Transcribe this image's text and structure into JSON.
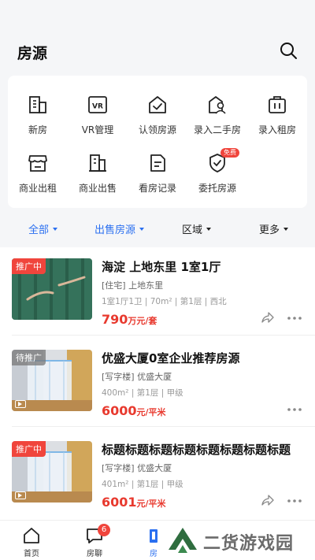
{
  "header": {
    "title": "房源"
  },
  "grid": [
    {
      "label": "新房",
      "icon": "building-icon"
    },
    {
      "label": "VR管理",
      "icon": "vr-icon"
    },
    {
      "label": "认领房源",
      "icon": "claim-house-icon"
    },
    {
      "label": "录入二手房",
      "icon": "add-used-house-icon"
    },
    {
      "label": "录入租房",
      "icon": "add-rental-icon"
    },
    {
      "label": "商业出租",
      "icon": "shop-icon"
    },
    {
      "label": "商业出售",
      "icon": "office-building-icon"
    },
    {
      "label": "看房记录",
      "icon": "record-icon"
    },
    {
      "label": "委托房源",
      "icon": "entrust-shield-icon",
      "badge": "免费"
    }
  ],
  "filters": [
    {
      "label": "全部",
      "active": true
    },
    {
      "label": "出售房源",
      "active": true
    },
    {
      "label": "区域",
      "active": false
    },
    {
      "label": "更多",
      "active": false
    }
  ],
  "listings": [
    {
      "tag": "推广中",
      "title": "海淀 上地东里 1室1厅",
      "sub": "[住宅] 上地东里",
      "meta": "1室1厅1卫 | 70m² | 第1层 | 西北",
      "price": "790",
      "unit": "万元/套",
      "video": false
    },
    {
      "tag": "待推广",
      "title": "优盛大厦0室企业推荐房源",
      "sub": "[写字楼] 优盛大厦",
      "meta": "400m² | 第1层 | 甲级",
      "price": "6000",
      "unit": "元/平米",
      "video": true
    },
    {
      "tag": "推广中",
      "title": "标题标题标题标题标题标题标题标题",
      "sub": "[写字楼] 优盛大厦",
      "meta": "401m² | 第1层 | 甲级",
      "price": "6001",
      "unit": "元/平米",
      "video": true
    }
  ],
  "nav": [
    {
      "label": "首页",
      "icon": "home-icon"
    },
    {
      "label": "房聊",
      "icon": "chat-icon",
      "badge": "6"
    },
    {
      "label": "房",
      "icon": "house-list-icon"
    }
  ],
  "watermark": "二货游戏园",
  "colors": {
    "accent": "#2a6ff0",
    "price": "#e8392e",
    "badge": "#f0453c"
  }
}
